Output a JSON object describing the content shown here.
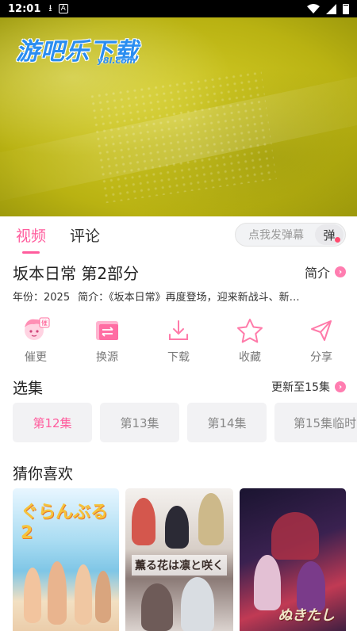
{
  "status_bar": {
    "time": "12:01",
    "icons": [
      "download-icon",
      "a-icon",
      "wifi-icon",
      "signal-icon",
      "battery-icon"
    ]
  },
  "player": {
    "logo_main": "游吧乐下载",
    "logo_sub": "y8l.com"
  },
  "tabs": [
    {
      "label": "视频",
      "active": true
    },
    {
      "label": "评论",
      "active": false
    }
  ],
  "danmu": {
    "placeholder": "点我发弹幕",
    "button_label": "弹"
  },
  "show": {
    "title": "坂本日常 第2部分",
    "intro_label": "简介",
    "year": "年份：2025",
    "summary": "简介：《坂本日常》再度登场，迎来新战斗、新…"
  },
  "actions": [
    {
      "label": "催更",
      "icon": "mascot-icon"
    },
    {
      "label": "换源",
      "icon": "switch-source-icon"
    },
    {
      "label": "下载",
      "icon": "download-icon"
    },
    {
      "label": "收藏",
      "icon": "star-icon"
    },
    {
      "label": "分享",
      "icon": "share-icon"
    }
  ],
  "episodes": {
    "title": "选集",
    "update_label": "更新至15集",
    "items": [
      {
        "label": "第12集",
        "active": true
      },
      {
        "label": "第13集",
        "active": false
      },
      {
        "label": "第14集",
        "active": false
      },
      {
        "label": "第15集临时",
        "active": false
      }
    ]
  },
  "recommend": {
    "title": "猜你喜欢",
    "items": [
      {
        "poster_text": "ぐらんぶる2"
      },
      {
        "poster_text": "薫る花は凛と咲く"
      },
      {
        "poster_text": "ぬきたし"
      }
    ]
  },
  "colors": {
    "accent": "#ff5c9d",
    "player_bg": "#c9c11d"
  }
}
